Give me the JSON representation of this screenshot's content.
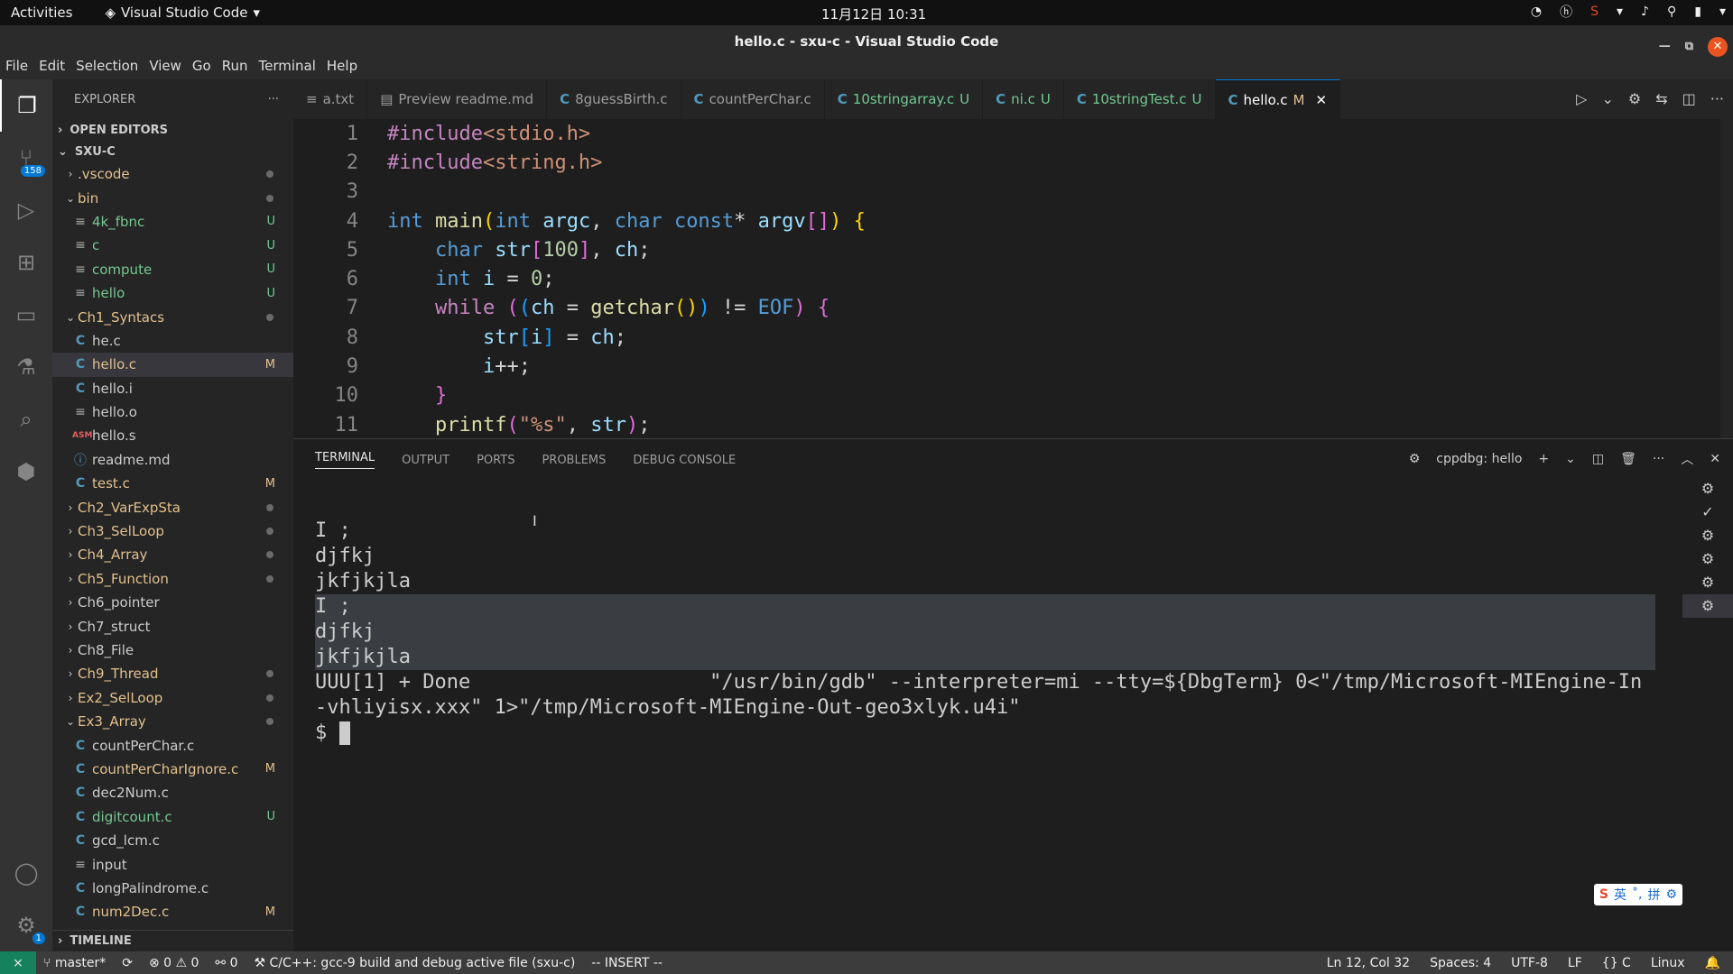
{
  "topbar": {
    "activities": "Activities",
    "app": "Visual Studio Code",
    "clock": "11月12日  10:31"
  },
  "window": {
    "title": "hello.c - sxu-c - Visual Studio Code"
  },
  "menu": [
    "File",
    "Edit",
    "Selection",
    "View",
    "Go",
    "Run",
    "Terminal",
    "Help"
  ],
  "activity": {
    "scm_badge": "158",
    "manage_badge": "1"
  },
  "explorer": {
    "header": "EXPLORER",
    "open_editors": "OPEN EDITORS",
    "root": "SXU-C",
    "timeline": "TIMELINE",
    "items": [
      {
        "label": ".vscode",
        "type": "folder",
        "open": false,
        "indent": 1,
        "status": "dot"
      },
      {
        "label": "bin",
        "type": "folder",
        "open": true,
        "indent": 1,
        "status": "dot"
      },
      {
        "label": "4k_fbnc",
        "type": "txt",
        "indent": 2,
        "status": "U"
      },
      {
        "label": "c",
        "type": "txt",
        "indent": 2,
        "status": "U"
      },
      {
        "label": "compute",
        "type": "txt",
        "indent": 2,
        "status": "U"
      },
      {
        "label": "hello",
        "type": "txt",
        "indent": 2,
        "status": "U"
      },
      {
        "label": "Ch1_Syntacs",
        "type": "folder",
        "open": true,
        "indent": 1,
        "status": "dot"
      },
      {
        "label": "he.c",
        "type": "c",
        "indent": 2,
        "status": ""
      },
      {
        "label": "hello.c",
        "type": "c",
        "indent": 2,
        "status": "M",
        "selected": true
      },
      {
        "label": "hello.i",
        "type": "c",
        "indent": 2,
        "status": ""
      },
      {
        "label": "hello.o",
        "type": "txt",
        "indent": 2,
        "status": ""
      },
      {
        "label": "hello.s",
        "type": "asm",
        "indent": 2,
        "status": ""
      },
      {
        "label": "readme.md",
        "type": "info",
        "indent": 2,
        "status": ""
      },
      {
        "label": "test.c",
        "type": "c",
        "indent": 2,
        "status": "M"
      },
      {
        "label": "Ch2_VarExpSta",
        "type": "folder",
        "open": false,
        "indent": 1,
        "status": "dot"
      },
      {
        "label": "Ch3_SelLoop",
        "type": "folder",
        "open": false,
        "indent": 1,
        "status": "dot"
      },
      {
        "label": "Ch4_Array",
        "type": "folder",
        "open": false,
        "indent": 1,
        "status": "dot"
      },
      {
        "label": "Ch5_Function",
        "type": "folder",
        "open": false,
        "indent": 1,
        "status": "dot"
      },
      {
        "label": "Ch6_pointer",
        "type": "folder",
        "open": false,
        "indent": 1,
        "status": ""
      },
      {
        "label": "Ch7_struct",
        "type": "folder",
        "open": false,
        "indent": 1,
        "status": ""
      },
      {
        "label": "Ch8_File",
        "type": "folder",
        "open": false,
        "indent": 1,
        "status": ""
      },
      {
        "label": "Ch9_Thread",
        "type": "folder",
        "open": false,
        "indent": 1,
        "status": "dot"
      },
      {
        "label": "Ex2_SelLoop",
        "type": "folder",
        "open": false,
        "indent": 1,
        "status": "dot"
      },
      {
        "label": "Ex3_Array",
        "type": "folder",
        "open": true,
        "indent": 1,
        "status": "dot"
      },
      {
        "label": "countPerChar.c",
        "type": "c",
        "indent": 2,
        "status": ""
      },
      {
        "label": "countPerCharIgnore.c",
        "type": "c",
        "indent": 2,
        "status": "M"
      },
      {
        "label": "dec2Num.c",
        "type": "c",
        "indent": 2,
        "status": ""
      },
      {
        "label": "digitcount.c",
        "type": "c",
        "indent": 2,
        "status": "U"
      },
      {
        "label": "gcd_lcm.c",
        "type": "c",
        "indent": 2,
        "status": ""
      },
      {
        "label": "input",
        "type": "txt",
        "indent": 2,
        "status": ""
      },
      {
        "label": "longPalindrome.c",
        "type": "c",
        "indent": 2,
        "status": ""
      },
      {
        "label": "num2Dec.c",
        "type": "c",
        "indent": 2,
        "status": "M"
      }
    ]
  },
  "tabs": [
    {
      "label": "a.txt",
      "icon": "≡",
      "status": ""
    },
    {
      "label": "Preview readme.md",
      "icon": "▤",
      "status": ""
    },
    {
      "label": "8guessBirth.c",
      "icon": "C",
      "status": ""
    },
    {
      "label": "countPerChar.c",
      "icon": "C",
      "status": ""
    },
    {
      "label": "10stringarray.c",
      "icon": "C",
      "status": "U"
    },
    {
      "label": "ni.c",
      "icon": "C",
      "status": "U"
    },
    {
      "label": "10stringTest.c",
      "icon": "C",
      "status": "U"
    },
    {
      "label": "hello.c",
      "icon": "C",
      "status": "M",
      "active": true
    }
  ],
  "code": {
    "line_numbers": [
      "1",
      "2",
      "3",
      "4",
      "5",
      "6",
      "7",
      "8",
      "9",
      "10",
      "11"
    ]
  },
  "panel": {
    "tabs": [
      "TERMINAL",
      "OUTPUT",
      "PORTS",
      "PROBLEMS",
      "DEBUG CONSOLE"
    ],
    "terminal_name": "cppdbg: hello",
    "lines": [
      {
        "text": "I ;",
        "hl": false
      },
      {
        "text": "djfkj",
        "hl": false
      },
      {
        "text": "jkfjkjla",
        "hl": false
      },
      {
        "text": "I ;",
        "hl": true
      },
      {
        "text": "djfkj",
        "hl": true
      },
      {
        "text": "jkfjkjla",
        "hl": true
      },
      {
        "text": "UUU[1] + Done                    \"/usr/bin/gdb\" --interpreter=mi --tty=${DbgTerm} 0<\"/tmp/Microsoft-MIEngine-In",
        "hl": false
      },
      {
        "text": "-vhliyisx.xxx\" 1>\"/tmp/Microsoft-MIEngine-Out-geo3xlyk.u4i\"",
        "hl": false
      }
    ],
    "prompt": "$ "
  },
  "status": {
    "branch": "master*",
    "problems": "⊗ 0 ⚠ 0",
    "ports": "⚯ 0",
    "task": "C/C++: gcc-9 build and debug active file (sxu-c)",
    "mode": "-- INSERT --",
    "position": "Ln 12, Col 32",
    "spaces": "Spaces: 4",
    "encoding": "UTF-8",
    "eol": "LF",
    "language": "C",
    "os": "Linux"
  },
  "ime": {
    "lang": "英",
    "punct": "˚,",
    "mode": "拼"
  }
}
